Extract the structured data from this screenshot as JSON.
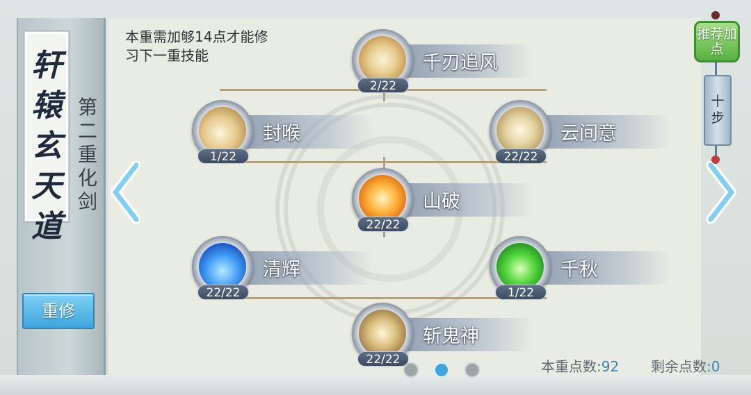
{
  "panel": {
    "title_chars": [
      "轩",
      "辕",
      "玄",
      "天",
      "道"
    ],
    "subtitle_chars": [
      "第",
      "二",
      "重",
      "化",
      "剑"
    ],
    "reset_label": "重修"
  },
  "hint": "本重需加够14点才能修习下一重技能",
  "skills": [
    {
      "name": "千刃追风",
      "points": "2/22",
      "icon": "blade-wind-icon"
    },
    {
      "name": "封喉",
      "points": "1/22",
      "icon": "seal-throat-icon"
    },
    {
      "name": "云间意",
      "points": "22/22",
      "icon": "cloud-intent-icon"
    },
    {
      "name": "山破",
      "points": "22/22",
      "icon": "mountain-break-icon"
    },
    {
      "name": "清辉",
      "points": "22/22",
      "icon": "blue-shield-icon"
    },
    {
      "name": "千秋",
      "points": "1/22",
      "icon": "green-shield-icon"
    },
    {
      "name": "斩鬼神",
      "points": "22/22",
      "icon": "ghost-slash-icon"
    }
  ],
  "controls": {
    "recommend_label": "推荐加点",
    "step_label": "十步"
  },
  "status": {
    "tier_points_label": "本重点数:",
    "tier_points_value": "92",
    "remaining_label": "剩余点数:",
    "remaining_value": "0"
  },
  "pagination": {
    "total": 3,
    "active": 2
  },
  "colors": {
    "accent_blue": "#3ea6dc",
    "recommend_green": "#58b040",
    "line_brown": "#b29f7d"
  }
}
